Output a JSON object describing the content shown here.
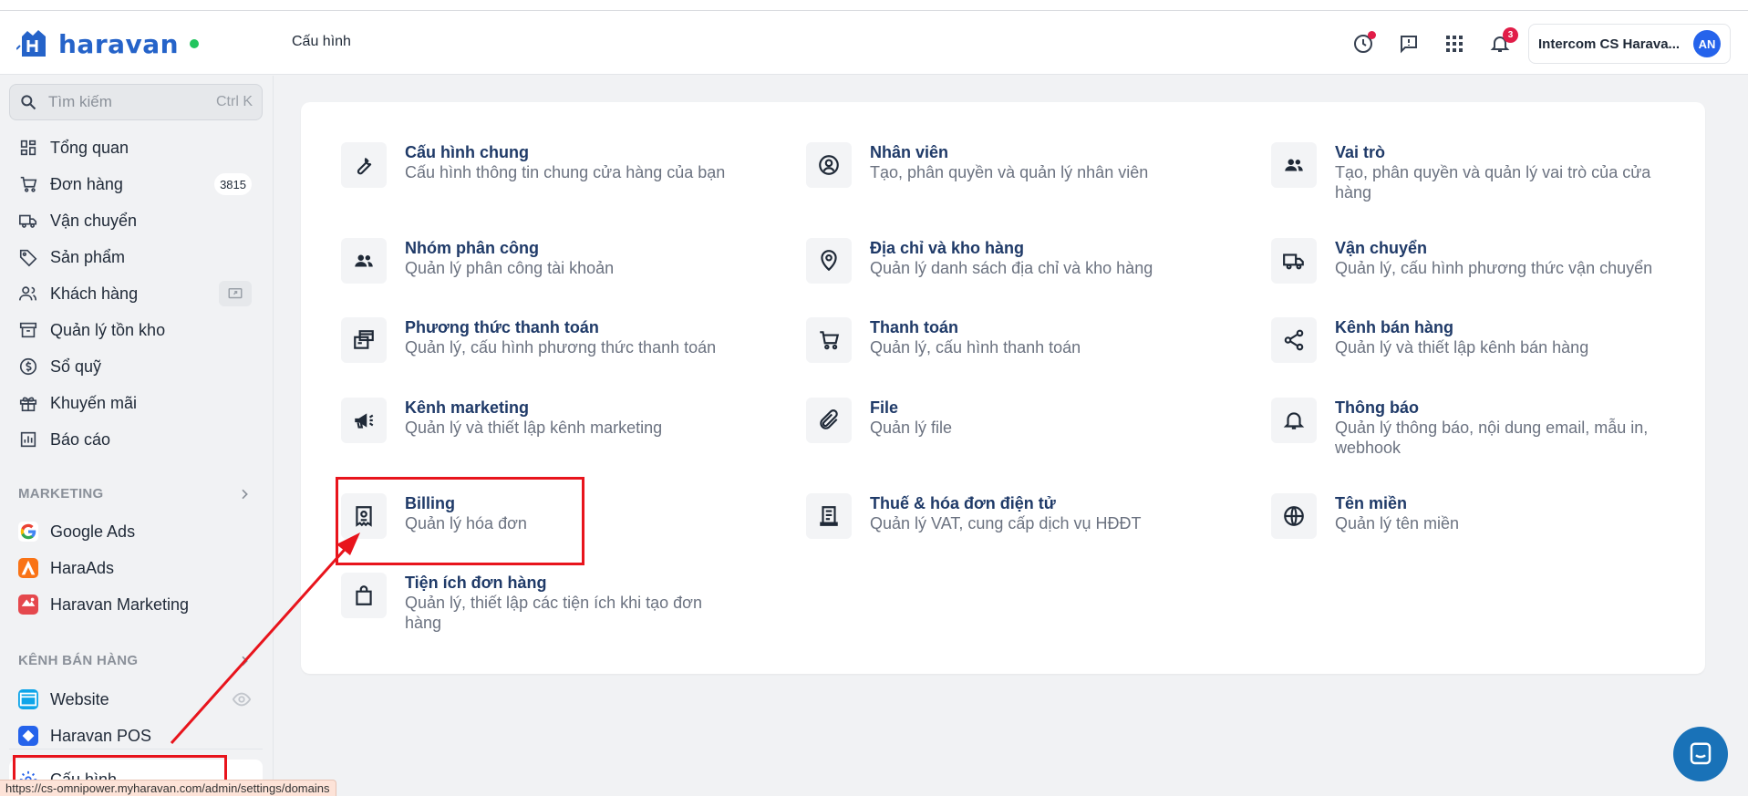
{
  "header": {
    "logo_text": "haravan",
    "page_title": "Cấu hình",
    "notification_count": "3",
    "account_name": "Intercom CS Harava...",
    "avatar_initials": "AN",
    "brand_color": "#2563c9"
  },
  "search": {
    "placeholder": "Tìm kiếm",
    "shortcut": "Ctrl K"
  },
  "sidebar": {
    "items": [
      {
        "label": "Tổng quan",
        "icon": "dashboard-icon"
      },
      {
        "label": "Đơn hàng",
        "icon": "cart-icon",
        "count": "3815"
      },
      {
        "label": "Vận chuyển",
        "icon": "truck-icon"
      },
      {
        "label": "Sản phẩm",
        "icon": "tag-icon"
      },
      {
        "label": "Khách hàng",
        "icon": "users-icon"
      },
      {
        "label": "Quản lý tồn kho",
        "icon": "inventory-icon"
      },
      {
        "label": "Sổ quỹ",
        "icon": "cash-icon"
      },
      {
        "label": "Khuyến mãi",
        "icon": "gift-icon"
      },
      {
        "label": "Báo cáo",
        "icon": "report-icon"
      }
    ],
    "marketing_title": "MARKETING",
    "marketing_items": [
      {
        "label": "Google Ads",
        "icon": "google-icon"
      },
      {
        "label": "HaraAds",
        "icon": "haraads-icon"
      },
      {
        "label": "Haravan Marketing",
        "icon": "haravan-marketing-icon"
      }
    ],
    "channels_title": "KÊNH BÁN HÀNG",
    "channel_items": [
      {
        "label": "Website",
        "icon": "website-icon"
      },
      {
        "label": "Haravan POS",
        "icon": "pos-icon"
      }
    ],
    "active_item": "Cấu hình"
  },
  "settings": [
    {
      "title": "Cấu hình chung",
      "desc": "Cấu hình thông tin chung cửa hàng của bạn",
      "icon": "wrench-icon"
    },
    {
      "title": "Nhân viên",
      "desc": "Tạo, phân quyền và quản lý nhân viên",
      "icon": "user-circle-icon"
    },
    {
      "title": "Vai trò",
      "desc": "Tạo, phân quyền và quản lý vai trò của cửa hàng",
      "icon": "people-icon"
    },
    {
      "title": "Nhóm phân công",
      "desc": "Quản lý phân công tài khoản",
      "icon": "group-icon"
    },
    {
      "title": "Địa chỉ và kho hàng",
      "desc": "Quản lý danh sách địa chỉ và kho hàng",
      "icon": "location-icon"
    },
    {
      "title": "Vận chuyển",
      "desc": "Quản lý, cấu hình phương thức vận chuyển",
      "icon": "truck-icon"
    },
    {
      "title": "Phương thức thanh toán",
      "desc": "Quản lý, cấu hình phương thức thanh toán",
      "icon": "payment-method-icon"
    },
    {
      "title": "Thanh toán",
      "desc": "Quản lý, cấu hình thanh toán",
      "icon": "cart-icon"
    },
    {
      "title": "Kênh bán hàng",
      "desc": "Quản lý và thiết lập kênh bán hàng",
      "icon": "share-icon"
    },
    {
      "title": "Kênh marketing",
      "desc": "Quản lý và thiết lập kênh marketing",
      "icon": "megaphone-icon"
    },
    {
      "title": "File",
      "desc": "Quản lý file",
      "icon": "paperclip-icon"
    },
    {
      "title": "Thông báo",
      "desc": "Quản lý thông báo, nội dung email, mẫu in, webhook",
      "icon": "bell-icon"
    },
    {
      "title": "Billing",
      "desc": "Quản lý hóa đơn",
      "icon": "receipt-icon"
    },
    {
      "title": "Thuế & hóa đơn điện tử",
      "desc": "Quản lý VAT, cung cấp dịch vụ HĐĐT",
      "icon": "invoice-icon"
    },
    {
      "title": "Tên miền",
      "desc": "Quản lý tên miền",
      "icon": "globe-icon"
    },
    {
      "title": "Tiện ích đơn hàng",
      "desc": "Quản lý, thiết lập các tiện ích khi tạo đơn hàng",
      "icon": "bag-icon"
    }
  ],
  "status_bar": {
    "url": "https://cs-omnipower.myharavan.com/admin/settings/domains"
  },
  "colors": {
    "annotation": "#e8141c",
    "title": "#1f3a68",
    "chat": "#1972b8"
  }
}
